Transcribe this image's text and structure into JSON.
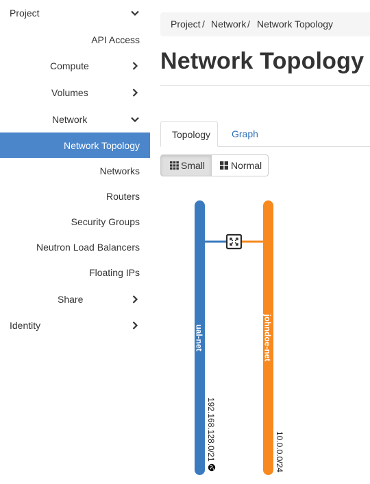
{
  "sidebar": {
    "project": "Project",
    "api_access": "API Access",
    "compute": "Compute",
    "volumes": "Volumes",
    "network": "Network",
    "network_topology": "Network Topology",
    "networks": "Networks",
    "routers": "Routers",
    "security_groups": "Security Groups",
    "neutron_lb": "Neutron Load Balancers",
    "floating_ips": "Floating IPs",
    "share": "Share",
    "identity": "Identity"
  },
  "breadcrumb": {
    "project": "Project",
    "network": "Network",
    "current": "Network Topology",
    "sep": "/"
  },
  "page_title": "Network Topology",
  "tabs": {
    "topology": "Topology",
    "graph": "Graph"
  },
  "size_toggle": {
    "small": "Small",
    "normal": "Normal",
    "selected": "Small"
  },
  "networks": [
    {
      "name": "ual-net",
      "cidr": "192.168.128.0/21",
      "color": "#3a7bbf",
      "external": true
    },
    {
      "name": "johndoe-net",
      "cidr": "10.0.0.0/24",
      "color": "#f7891f",
      "external": false
    }
  ],
  "colors": {
    "active_nav": "#4b86cb",
    "link": "#2f6fb5"
  }
}
